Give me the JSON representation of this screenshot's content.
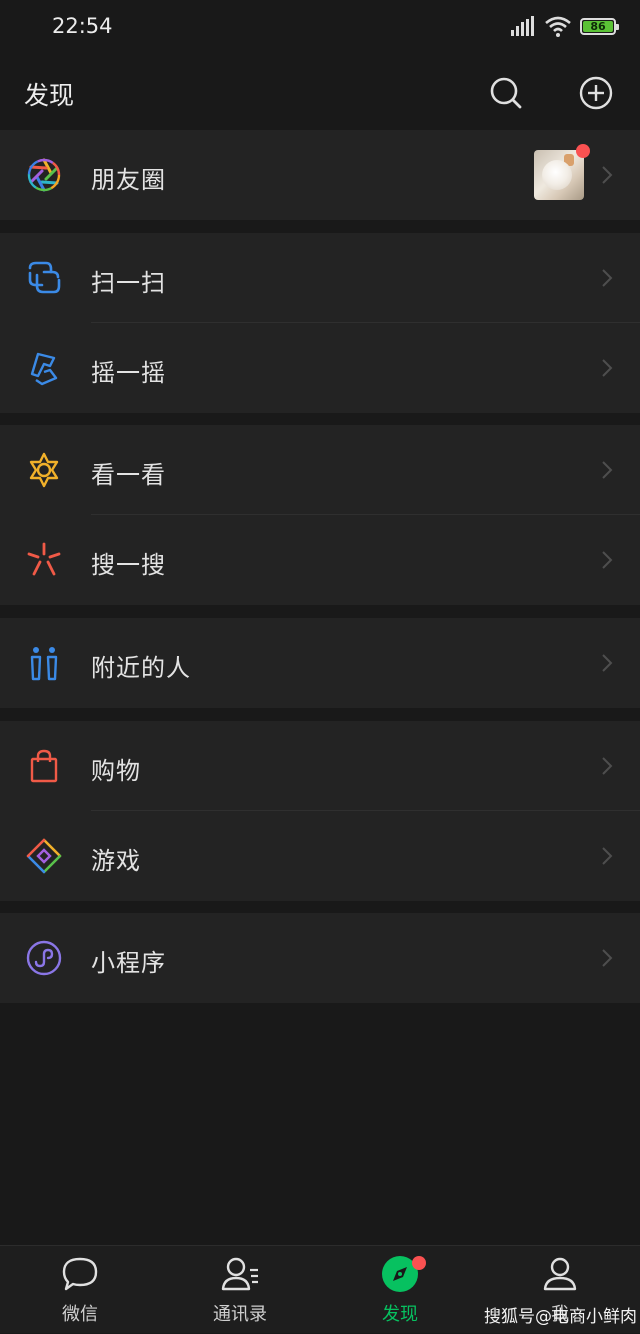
{
  "status_bar": {
    "time": "22:54",
    "battery_level": "86"
  },
  "header": {
    "title": "发现",
    "search_icon": "search-icon",
    "add_icon": "plus-circle-icon"
  },
  "moments": {
    "label": "朋友圈",
    "icon": "aperture-icon",
    "has_badge": true
  },
  "groups": [
    [
      {
        "label": "朋友圈",
        "icon": "aperture-icon"
      }
    ],
    [
      {
        "label": "扫一扫",
        "icon": "scan-icon"
      },
      {
        "label": "摇一摇",
        "icon": "shake-icon"
      }
    ],
    [
      {
        "label": "看一看",
        "icon": "top-stories-icon"
      },
      {
        "label": "搜一搜",
        "icon": "search-spark-icon"
      }
    ],
    [
      {
        "label": "附近的人",
        "icon": "people-nearby-icon"
      }
    ],
    [
      {
        "label": "购物",
        "icon": "shopping-bag-icon"
      },
      {
        "label": "游戏",
        "icon": "game-diamond-icon"
      }
    ],
    [
      {
        "label": "小程序",
        "icon": "mini-program-icon"
      }
    ]
  ],
  "tabbar": {
    "tabs": [
      {
        "label": "微信",
        "icon": "chat-bubble-icon"
      },
      {
        "label": "通讯录",
        "icon": "contacts-icon"
      },
      {
        "label": "发现",
        "icon": "compass-icon",
        "active": true
      },
      {
        "label": "我",
        "icon": "person-icon"
      }
    ]
  },
  "watermark": "搜狐号@电商小鲜肉",
  "colors": {
    "accent": "#07c160",
    "badge": "#fa5151",
    "background": "#191919",
    "cell": "#232323"
  }
}
